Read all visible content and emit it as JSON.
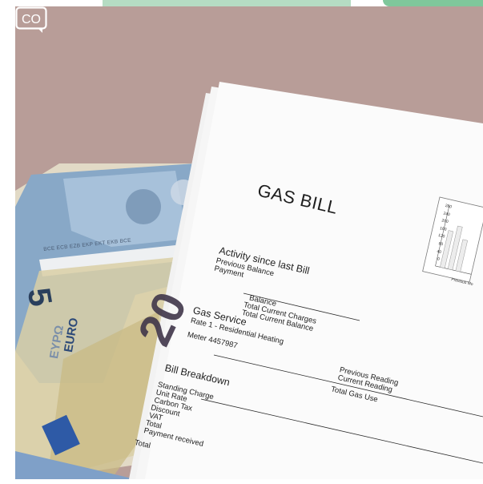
{
  "logo": {
    "text": "CO"
  },
  "bill": {
    "title": "GAS BILL",
    "activity": {
      "heading": "Activity since last Bill",
      "lines": [
        "Previous Balance",
        "Payment"
      ]
    },
    "balance_block": [
      "Balance",
      "Total Current Charges",
      "Total Current Balance"
    ],
    "gas_service": {
      "heading": "Gas Service",
      "rate": "Rate 1 - Residential Heating",
      "meter": "Meter 4457987"
    },
    "readings": [
      "Previous Reading",
      "Current Reading",
      "Total Gas Use"
    ],
    "breakdown": {
      "heading": "Bill Breakdown",
      "lines": [
        "Standing Charge",
        "Unit Rate",
        "Carbon Tax",
        "Discount",
        "VAT",
        "Total",
        "Payment received"
      ],
      "total": "Total"
    },
    "chart_ticks": [
      "280",
      "240",
      "200",
      "160",
      "120",
      "80",
      "40",
      "0"
    ],
    "chart_legend": "Previous Mo"
  },
  "banknote": {
    "five": "5",
    "twenty": "20",
    "euro": "EURO",
    "evro": "EYPΩ",
    "bank_codes": "BCE ECB EZB EKP EKT EKB BCE"
  }
}
